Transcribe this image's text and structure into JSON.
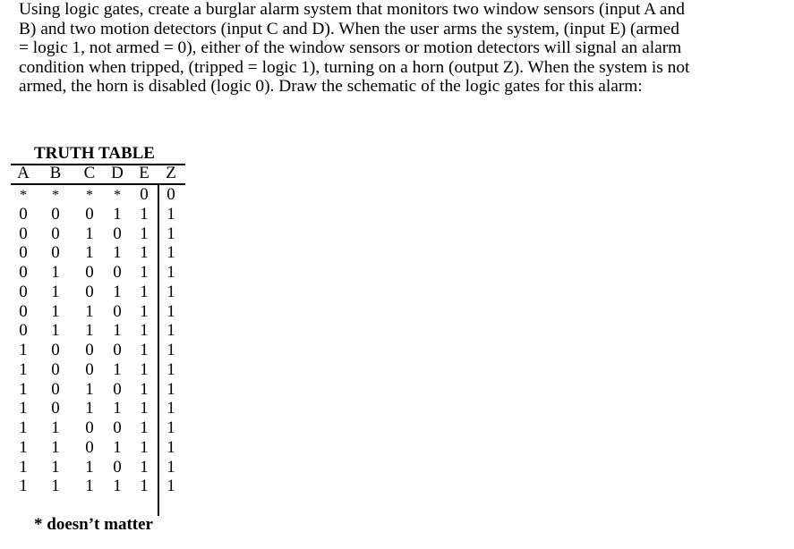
{
  "problem": {
    "lines": [
      "Using logic gates, create a burglar alarm system that monitors two window sensors (input A and",
      "B) and two motion detectors (input C and D).  When the user arms the system, (input E) (armed",
      "= logic 1, not armed = 0), either of the window sensors or motion detectors will signal an alarm",
      "condition when tripped, (tripped = logic 1), turning on a horn (output Z).  When the system is not",
      "armed, the horn is disabled (logic 0).  Draw the schematic of the logic gates for this alarm:"
    ]
  },
  "truth_table": {
    "title": "TRUTH TABLE",
    "headers": [
      "A",
      "B",
      "C",
      "D",
      "E",
      "Z"
    ],
    "rows": [
      [
        "*",
        "*",
        "*",
        "*",
        "0",
        "0"
      ],
      [
        "0",
        "0",
        "0",
        "1",
        "1",
        "1"
      ],
      [
        "0",
        "0",
        "1",
        "0",
        "1",
        "1"
      ],
      [
        "0",
        "0",
        "1",
        "1",
        "1",
        "1"
      ],
      [
        "0",
        "1",
        "0",
        "0",
        "1",
        "1"
      ],
      [
        "0",
        "1",
        "0",
        "1",
        "1",
        "1"
      ],
      [
        "0",
        "1",
        "1",
        "0",
        "1",
        "1"
      ],
      [
        "0",
        "1",
        "1",
        "1",
        "1",
        "1"
      ],
      [
        "1",
        "0",
        "0",
        "0",
        "1",
        "1"
      ],
      [
        "1",
        "0",
        "0",
        "1",
        "1",
        "1"
      ],
      [
        "1",
        "0",
        "1",
        "0",
        "1",
        "1"
      ],
      [
        "1",
        "0",
        "1",
        "1",
        "1",
        "1"
      ],
      [
        "1",
        "1",
        "0",
        "0",
        "1",
        "1"
      ],
      [
        "1",
        "1",
        "0",
        "1",
        "1",
        "1"
      ],
      [
        "1",
        "1",
        "1",
        "0",
        "1",
        "1"
      ],
      [
        "1",
        "1",
        "1",
        "1",
        "1",
        "1"
      ]
    ],
    "footnote": "* doesn’t matter"
  }
}
